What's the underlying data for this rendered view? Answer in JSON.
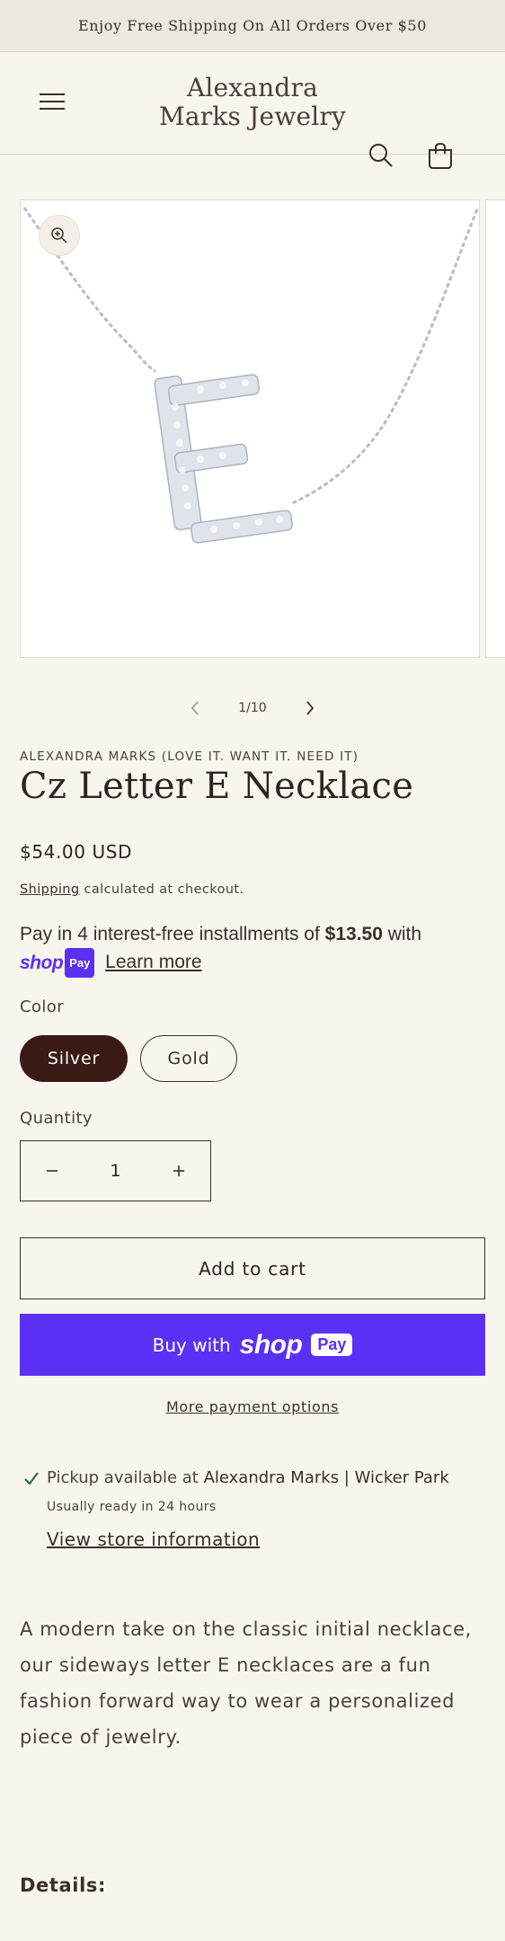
{
  "announcement": "Enjoy Free Shipping On All Orders Over $50",
  "brand": {
    "line1": "Alexandra",
    "line2": "Marks Jewelry"
  },
  "gallery": {
    "counter": "1/10"
  },
  "product": {
    "vendor": "ALEXANDRA MARKS (LOVE IT. WANT IT. NEED IT)",
    "title": "Cz Letter E Necklace",
    "price": "$54.00 USD",
    "shipping_link": "Shipping",
    "shipping_rest": " calculated at checkout."
  },
  "installments": {
    "text_before": "Pay in 4 interest-free installments of ",
    "amount": "$13.50",
    "text_after": " with",
    "shop_word": "shop",
    "pay_word": "Pay",
    "learn_more": "Learn more"
  },
  "color": {
    "label": "Color",
    "options": [
      "Silver",
      "Gold"
    ],
    "selected": "Silver"
  },
  "quantity": {
    "label": "Quantity",
    "value": "1",
    "minus": "−",
    "plus": "+"
  },
  "buttons": {
    "add_to_cart": "Add to cart",
    "buy_with": "Buy with",
    "shop_word": "shop",
    "pay_word": "Pay",
    "more_payment": "More payment options"
  },
  "pickup": {
    "available_prefix": "Pickup available at ",
    "location": "Alexandra Marks | Wicker Park",
    "ready": "Usually ready in 24 hours",
    "store_link": "View store information"
  },
  "description": "A modern take on the classic initial necklace, our sideways letter E necklaces are a fun fashion forward way to wear a personalized piece of jewelry.",
  "details_heading": "Details:",
  "colors": {
    "accent": "#5a31f4",
    "selected_pill": "#3b1a15",
    "background": "#f8f5ef"
  },
  "icons": [
    "hamburger-menu-icon",
    "search-icon",
    "cart-icon",
    "zoom-icon",
    "chevron-left-icon",
    "chevron-right-icon",
    "minus-icon",
    "plus-icon",
    "checkmark-icon"
  ]
}
